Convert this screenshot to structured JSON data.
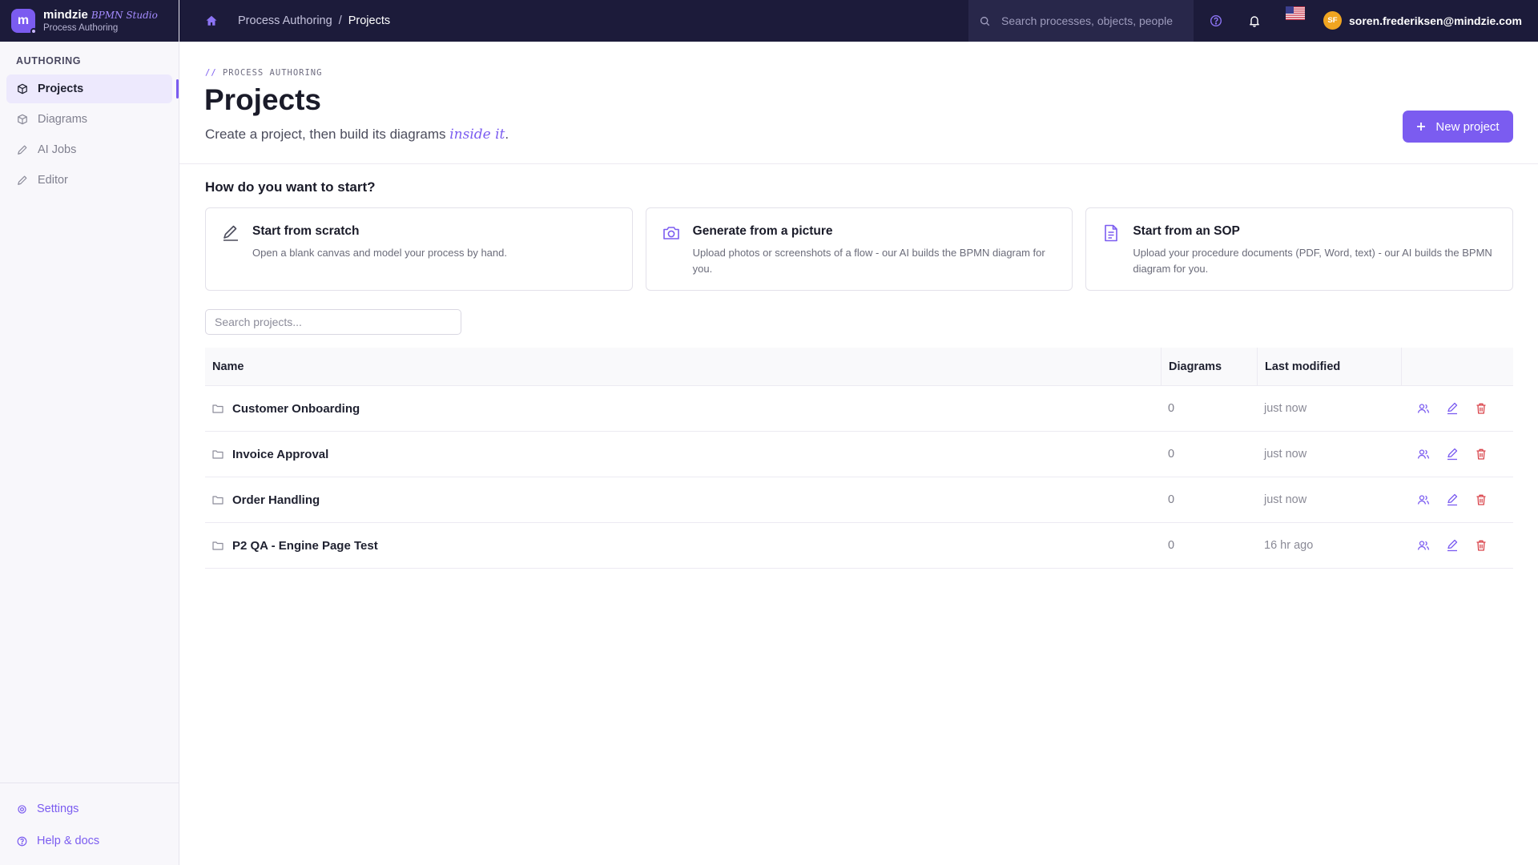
{
  "brand": {
    "name": "mindzie",
    "product": "BPMN Studio",
    "subtitle": "Process Authoring",
    "logo_letter": "m"
  },
  "sidebar": {
    "heading": "AUTHORING",
    "items": [
      {
        "label": "Projects",
        "icon": "cube-icon",
        "active": true
      },
      {
        "label": "Diagrams",
        "icon": "cube-icon",
        "active": false
      },
      {
        "label": "AI Jobs",
        "icon": "pencil-icon",
        "active": false
      },
      {
        "label": "Editor",
        "icon": "pencil-icon",
        "active": false
      }
    ],
    "footer": [
      {
        "label": "Settings",
        "icon": "gear-icon"
      },
      {
        "label": "Help & docs",
        "icon": "help-circle-icon"
      }
    ]
  },
  "topbar": {
    "breadcrumb": [
      "Process Authoring",
      "/",
      "Projects"
    ],
    "search_placeholder": "Search processes, objects, people",
    "user_initials": "SF",
    "user_email": "soren.frederiksen@mindzie.com"
  },
  "page": {
    "eyebrow_slashes": "//",
    "eyebrow": "PROCESS AUTHORING",
    "title": "Projects",
    "subtitle_pre": "Create a project, then build its diagrams ",
    "subtitle_accent": "inside it",
    "subtitle_post": ".",
    "new_button": "New project"
  },
  "start": {
    "heading": "How do you want to start?",
    "cards": [
      {
        "title": "Start from scratch",
        "desc": "Open a blank canvas and model your process by hand.",
        "icon": "pencil-icon"
      },
      {
        "title": "Generate from a picture",
        "desc": "Upload photos or screenshots of a flow - our AI builds the BPMN diagram for you.",
        "icon": "camera-icon"
      },
      {
        "title": "Start from an SOP",
        "desc": "Upload your procedure documents (PDF, Word, text) - our AI builds the BPMN diagram for you.",
        "icon": "document-icon"
      }
    ]
  },
  "projects": {
    "search_placeholder": "Search projects...",
    "columns": [
      "Name",
      "Diagrams",
      "Last modified"
    ],
    "rows": [
      {
        "name": "Customer Onboarding",
        "diagrams": "0",
        "modified": "just now"
      },
      {
        "name": "Invoice Approval",
        "diagrams": "0",
        "modified": "just now"
      },
      {
        "name": "Order Handling",
        "diagrams": "0",
        "modified": "just now"
      },
      {
        "name": "P2 QA - Engine Page Test",
        "diagrams": "0",
        "modified": "16 hr ago"
      }
    ]
  },
  "colors": {
    "accent": "#7b5cf0",
    "topbar": "#1c1b3a",
    "danger": "#d9434a",
    "avatar": "#f0a521"
  }
}
